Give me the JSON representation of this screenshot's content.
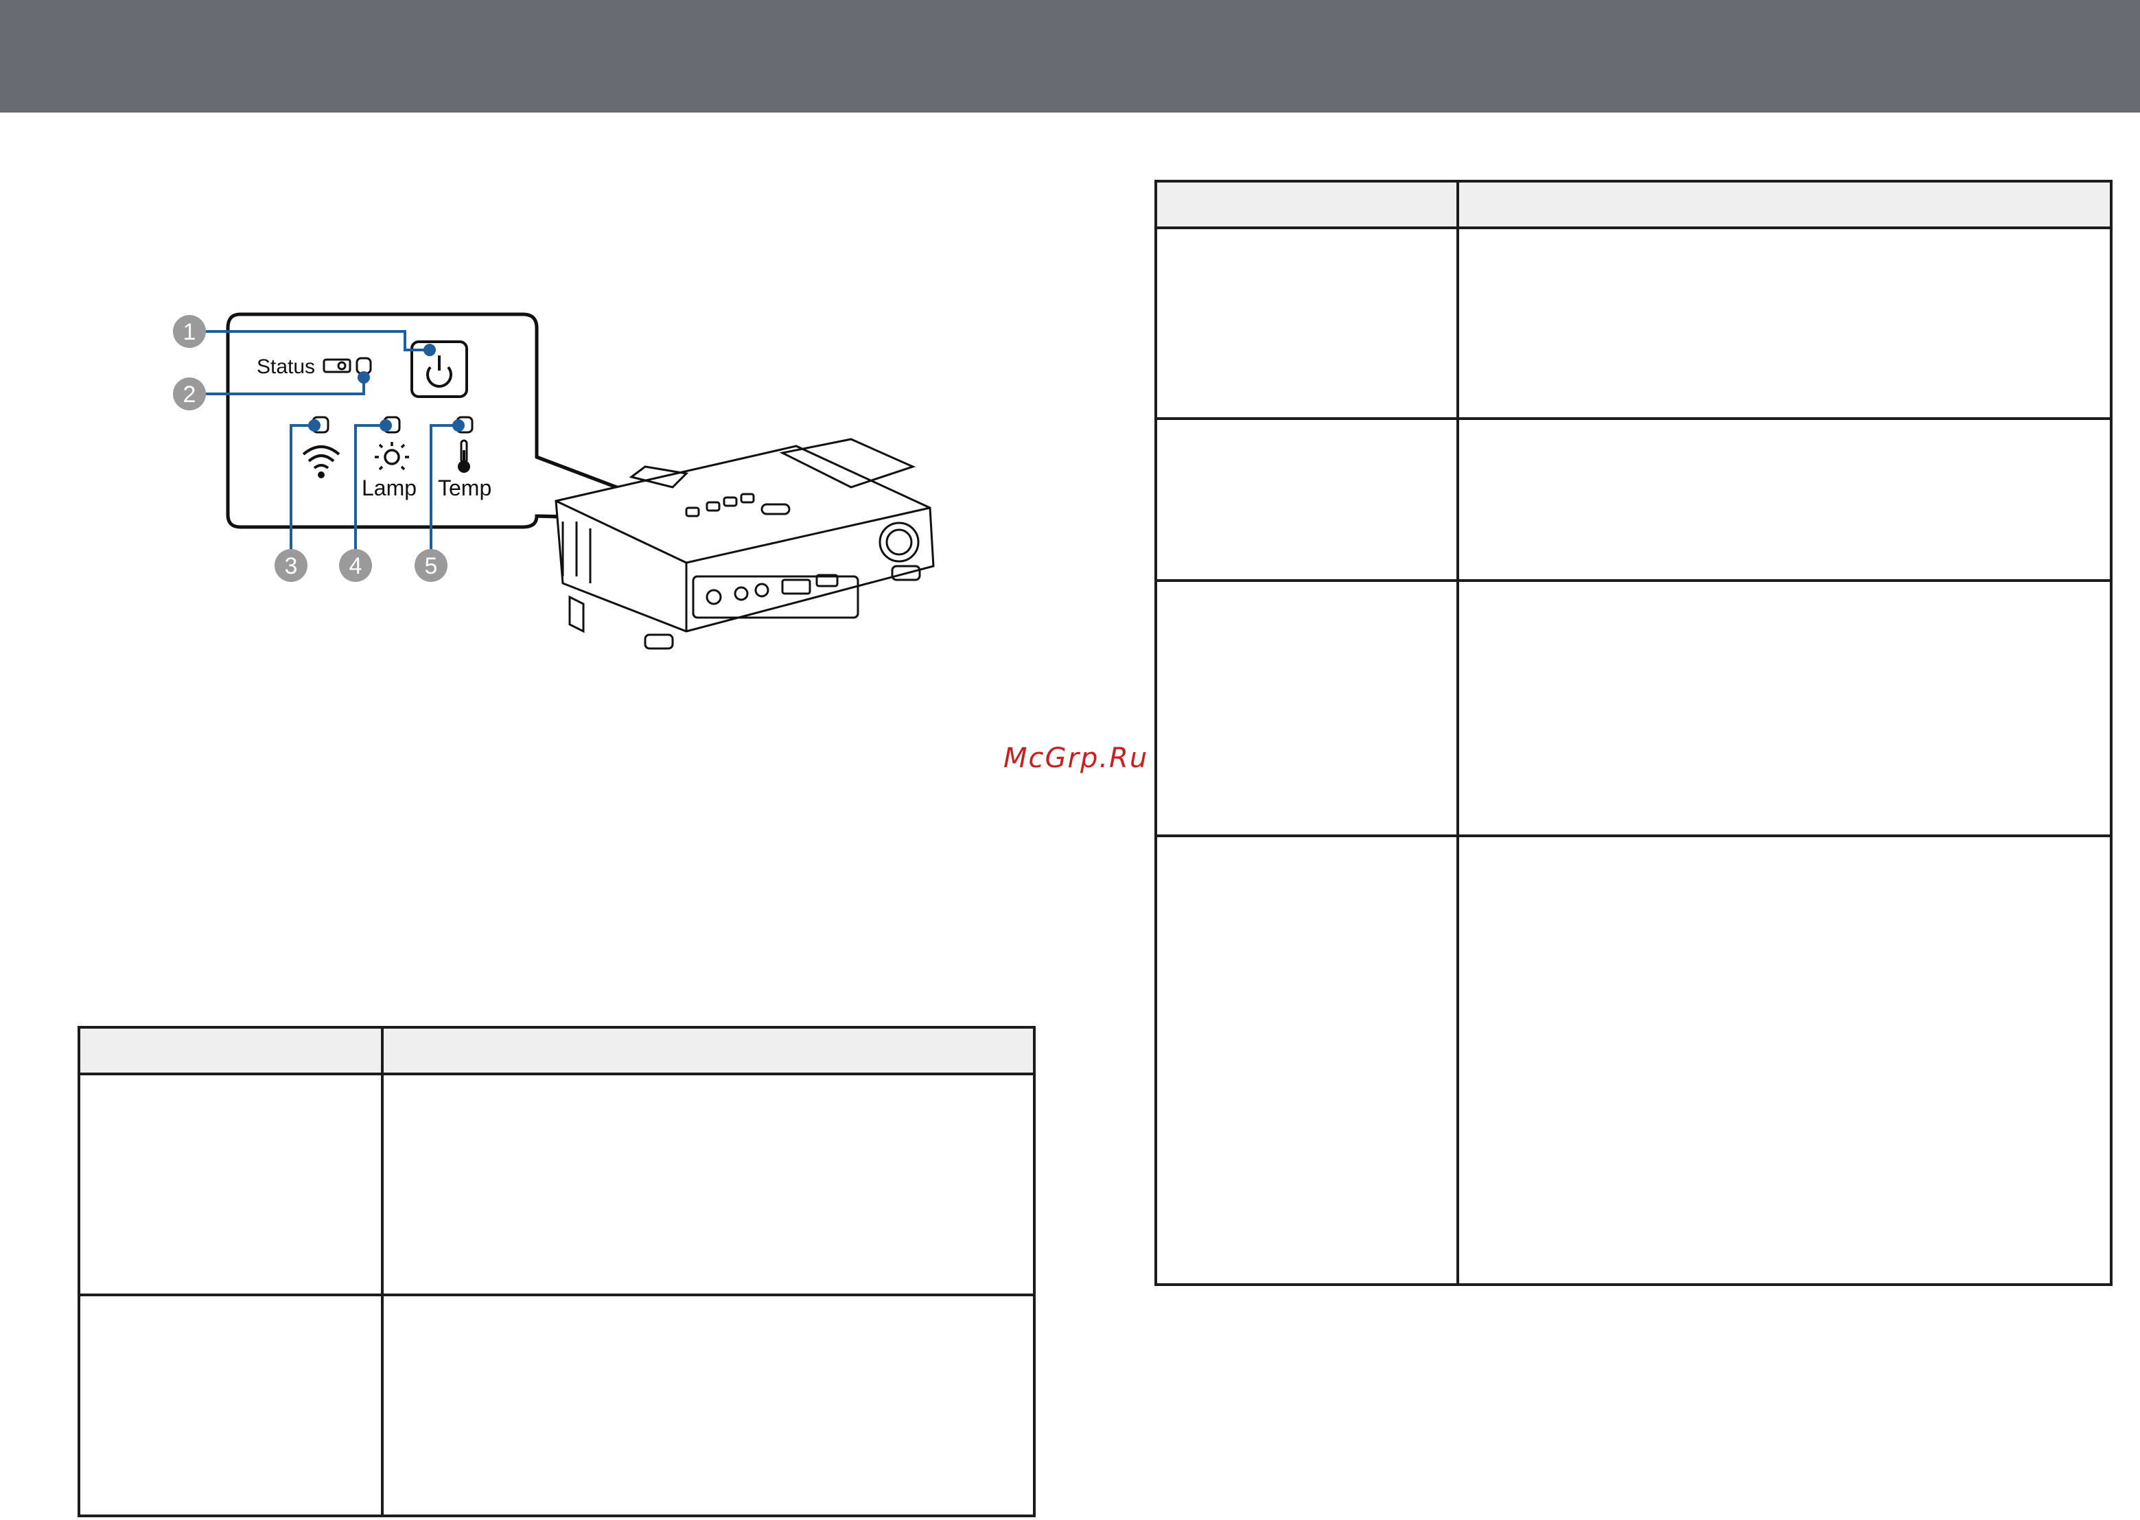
{
  "theme": {
    "header_color": "#696b73",
    "accent_blue": "#1f5d9b",
    "watermark_color": "#c8201f"
  },
  "watermark": {
    "text": "McGrp.Ru"
  },
  "control_panel": {
    "status_label": "Status",
    "lamp_label": "Lamp",
    "temp_label": "Temp",
    "callouts": [
      "1",
      "2",
      "3",
      "4",
      "5"
    ],
    "icons": [
      "power-icon",
      "projector-icon",
      "wifi-icon",
      "lamp-icon",
      "thermometer-icon"
    ]
  },
  "table_right": {
    "rows": 4
  },
  "table_left": {
    "rows": 2
  }
}
